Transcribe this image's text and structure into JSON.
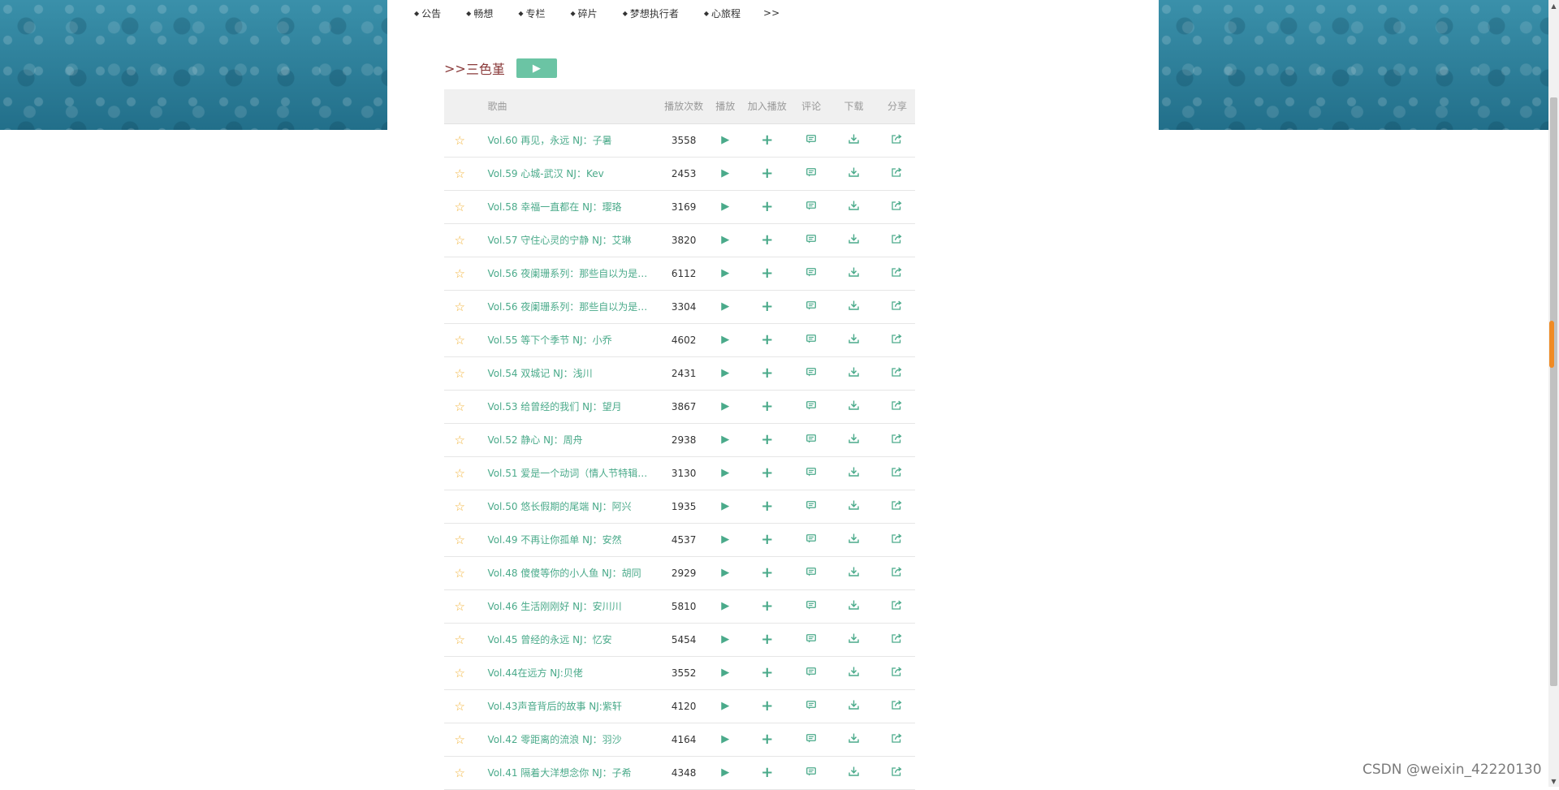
{
  "nav": {
    "items": [
      "公告",
      "畅想",
      "专栏",
      "碎片",
      "梦想执行者",
      "心旅程"
    ],
    "more": ">>"
  },
  "album": {
    "prefix": ">>",
    "name": "三色堇"
  },
  "table": {
    "headers": {
      "song": "歌曲",
      "plays": "播放次数",
      "play": "播放",
      "add": "加入播放",
      "comment": "评论",
      "download": "下载",
      "share": "分享"
    },
    "rows": [
      {
        "title": "Vol.60 再见，永远 NJ：子暑",
        "plays": "3558"
      },
      {
        "title": "Vol.59 心城-武汉 NJ：Kev",
        "plays": "2453"
      },
      {
        "title": "Vol.58 幸福一直都在 NJ：璎珞",
        "plays": "3169"
      },
      {
        "title": "Vol.57 守住心灵的宁静 NJ：艾琳",
        "plays": "3820"
      },
      {
        "title": "Vol.56 夜阑珊系列：那些自以为是的...",
        "plays": "6112"
      },
      {
        "title": "Vol.56 夜阑珊系列：那些自以为是的...",
        "plays": "3304"
      },
      {
        "title": "Vol.55 等下个季节 NJ：小乔",
        "plays": "4602"
      },
      {
        "title": "Vol.54 双城记 NJ：浅川",
        "plays": "2431"
      },
      {
        "title": "Vol.53 给曾经的我们 NJ：望月",
        "plays": "3867"
      },
      {
        "title": "Vol.52 静心 NJ：周舟",
        "plays": "2938"
      },
      {
        "title": "Vol.51 爱是一个动词（情人节特辑）...",
        "plays": "3130"
      },
      {
        "title": "Vol.50 悠长假期的尾端 NJ：阿兴",
        "plays": "1935"
      },
      {
        "title": "Vol.49 不再让你孤单 NJ：安然",
        "plays": "4537"
      },
      {
        "title": "Vol.48 傻傻等你的小人鱼 NJ：胡同",
        "plays": "2929"
      },
      {
        "title": "Vol.46 生活刚刚好 NJ：安川川",
        "plays": "5810"
      },
      {
        "title": "Vol.45 曾经的永远 NJ：忆安",
        "plays": "5454"
      },
      {
        "title": "Vol.44在远方 NJ:贝佬",
        "plays": "3552"
      },
      {
        "title": "Vol.43声音背后的故事 NJ:紫轩",
        "plays": "4120"
      },
      {
        "title": "Vol.42 零距离的流浪 NJ：羽沙",
        "plays": "4164"
      },
      {
        "title": "Vol.41 隔着大洋想念你 NJ：子希",
        "plays": "4348"
      }
    ]
  },
  "icons": {
    "star": "star-outline-icon",
    "play": "play-icon",
    "add": "plus-icon",
    "comment": "comment-icon",
    "download": "download-icon",
    "share": "share-icon"
  },
  "colors": {
    "accent_green": "#4aaa8a",
    "star_gold": "#f2b43a",
    "album_title": "#8a3a3a",
    "header_bg": "#f0f0f0",
    "play_button": "#6bc4a4",
    "banner_blue": "#2f7f99"
  },
  "watermark": "CSDN @weixin_42220130"
}
